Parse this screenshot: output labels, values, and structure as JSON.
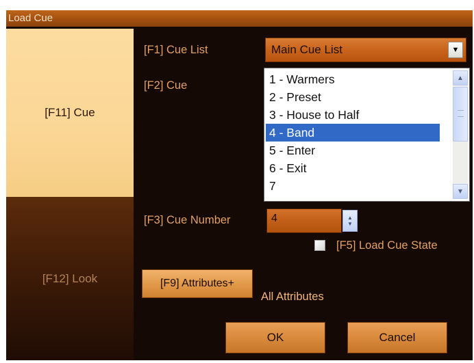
{
  "window": {
    "title": "Load Cue"
  },
  "tabs": {
    "cue": "[F11] Cue",
    "look": "[F12] Look"
  },
  "cue_list": {
    "label": "[F1] Cue List",
    "value": "Main Cue List"
  },
  "cue": {
    "label": "[F2] Cue",
    "items": [
      "1 - Warmers",
      "2 - Preset",
      "3 - House to Half",
      "4 - Band",
      "5 - Enter",
      "6 - Exit",
      "7"
    ],
    "selected_index": 3
  },
  "cue_number": {
    "label": "[F3] Cue Number",
    "value": "4"
  },
  "load_cue_state": {
    "label": "[F5] Load Cue State",
    "checked": false
  },
  "attributes": {
    "button_label": "[F9] Attributes+",
    "value": "All Attributes"
  },
  "buttons": {
    "ok": "OK",
    "cancel": "Cancel"
  },
  "icons": {
    "dropdown": "chevron-down-icon",
    "scroll_up": "scroll-up-icon",
    "scroll_down": "scroll-down-icon",
    "spinner": "spin-up-down-icon"
  },
  "colors": {
    "title_bar": "#a3500f",
    "active_tab": "#fbd796",
    "label_text": "#e3a066",
    "selection": "#3169c6"
  }
}
